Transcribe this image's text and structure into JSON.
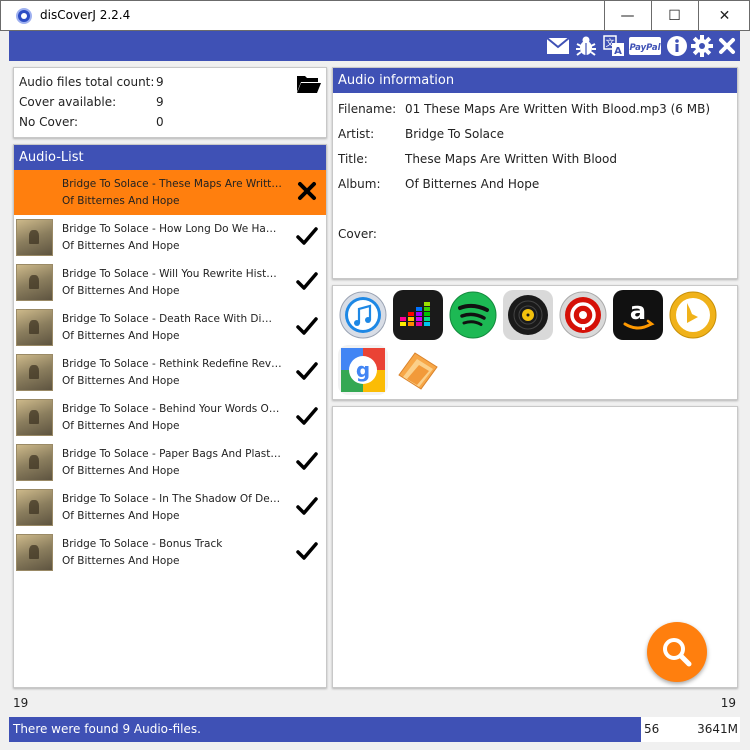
{
  "window": {
    "title": "disCoverJ 2.2.4",
    "controls": [
      "—",
      "☐",
      "✕"
    ]
  },
  "toolbar": {
    "icons": [
      "mail-icon",
      "bug-icon",
      "translate-icon",
      "paypal-icon",
      "info-icon",
      "gear-icon",
      "close-icon"
    ],
    "paypal_label": "PayPal"
  },
  "stats": {
    "total_label": "Audio files total count:",
    "total_value": "9",
    "cover_label": "Cover available:",
    "cover_value": "9",
    "nocover_label": "No Cover:",
    "nocover_value": "0"
  },
  "audio_list": {
    "header": "Audio-List",
    "items": [
      {
        "title": "Bridge To Solace - These Maps Are Written With Blood",
        "album": "Of Bitternes And Hope",
        "status": "missing",
        "selected": true
      },
      {
        "title": "Bridge To Solace - How Long Do We Have Left",
        "album": "Of Bitternes And Hope",
        "status": "ok"
      },
      {
        "title": "Bridge To Solace - Will You Rewrite History",
        "album": "Of Bitternes And Hope",
        "status": "ok"
      },
      {
        "title": "Bridge To Solace - Death Race With Dimensions",
        "album": "Of Bitternes And Hope",
        "status": "ok"
      },
      {
        "title": "Bridge To Solace - Rethink Redefine Revolt",
        "album": "Of Bitternes And Hope",
        "status": "ok"
      },
      {
        "title": "Bridge To Solace - Behind Your Words Of Hope",
        "album": "Of Bitternes And Hope",
        "status": "ok"
      },
      {
        "title": "Bridge To Solace - Paper Bags And Plastic Hearts",
        "album": "Of Bitternes And Hope",
        "status": "ok"
      },
      {
        "title": "Bridge To Solace - In The Shadow Of Death",
        "album": "Of Bitternes And Hope",
        "status": "ok"
      },
      {
        "title": "Bridge To Solace - Bonus Track",
        "album": "Of Bitternes And Hope",
        "status": "ok"
      }
    ]
  },
  "info": {
    "header": "Audio information",
    "filename_label": "Filename:",
    "filename_value": "01 These Maps Are Written With Blood.mp3 (6 MB)",
    "artist_label": "Artist:",
    "artist_value": "Bridge To Solace",
    "title_label": "Title:",
    "title_value": "These Maps Are Written With Blood",
    "album_label": "Album:",
    "album_value": "Of Bitternes And Hope",
    "cover_label": "Cover:"
  },
  "services": [
    "itunes-icon",
    "deezer-icon",
    "spotify-icon",
    "vinyl-icon",
    "lastfm-icon",
    "amazon-icon",
    "bing-icon",
    "google-icon",
    "folder-icon"
  ],
  "slider": {
    "min": "19",
    "max": "19"
  },
  "status": {
    "text": "There were found 9 Audio-files.",
    "mem_used": "56",
    "mem_total": "3641M",
    "fill_fraction": 0.865
  },
  "colors": {
    "primary": "#3f51b5",
    "accent": "#ff7f0e"
  }
}
